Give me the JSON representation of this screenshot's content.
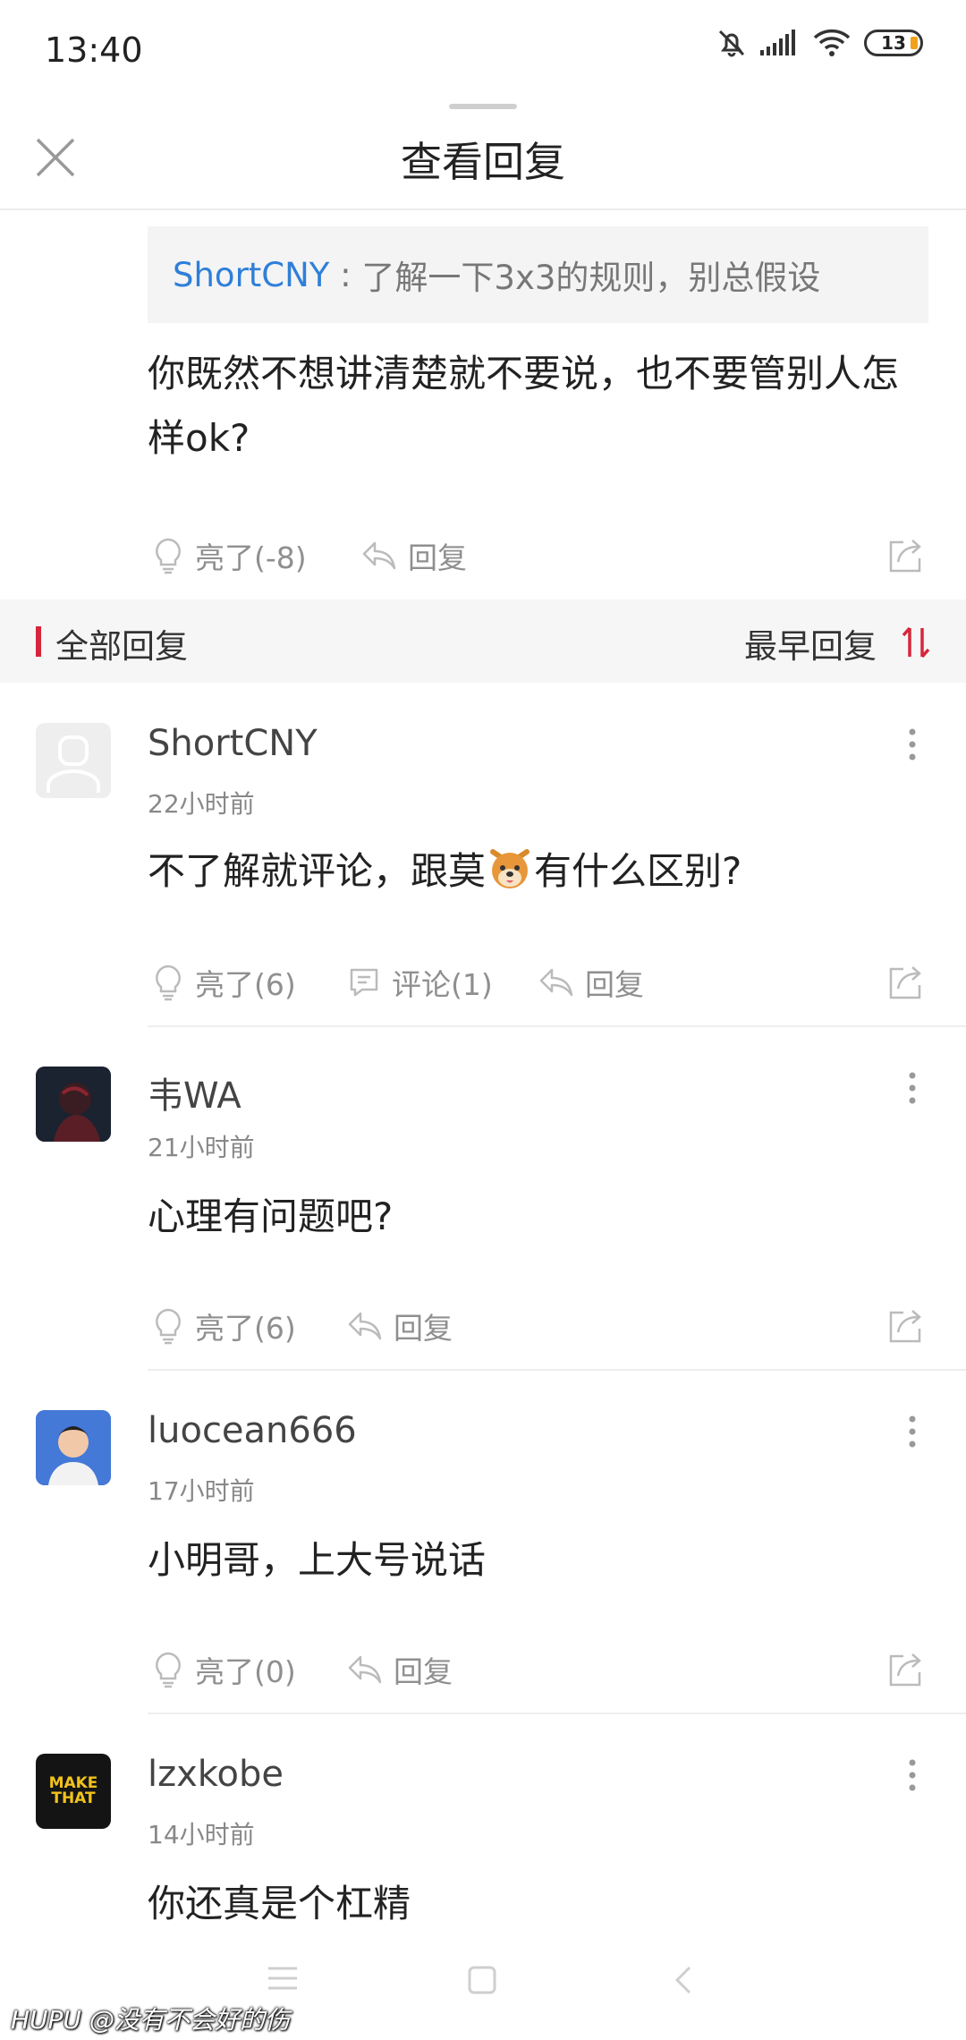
{
  "status_bar": {
    "time": "13:40",
    "battery": "13"
  },
  "header": {
    "title": "查看回复"
  },
  "reply_target": {
    "quote_author": "ShortCNY",
    "quote_sep": " : ",
    "quote_text": "了解一下3x3的规则，别总假设",
    "text": "你既然不想讲清楚就不要说，也不要管别人怎样ok?",
    "like_label": "亮了(-8)",
    "reply_label": "回复"
  },
  "section": {
    "title": "全部回复",
    "sort_label": "最早回复"
  },
  "comments": [
    {
      "username": "ShortCNY",
      "time": "22小时前",
      "content_pre": "不了解就评论，跟莫",
      "content_post": "有什么区别?",
      "like_label": "亮了(6)",
      "comment_label": "评论(1)",
      "reply_label": "回复"
    },
    {
      "username": "韦WA",
      "time": "21小时前",
      "content": "心理有问题吧?",
      "like_label": "亮了(6)",
      "reply_label": "回复"
    },
    {
      "username": "luocean666",
      "time": "17小时前",
      "content": "小明哥，上大号说话",
      "like_label": "亮了(0)",
      "reply_label": "回复"
    },
    {
      "username": "lzxkobe",
      "time": "14小时前",
      "content": "你还真是个杠精",
      "avatar_text": "MAKE THAT"
    }
  ],
  "watermark": "HUPU @没有不会好的伤",
  "colors": {
    "accent_red": "#d6263b",
    "link_blue": "#2e7fd9",
    "battery": "#f2a11a"
  }
}
